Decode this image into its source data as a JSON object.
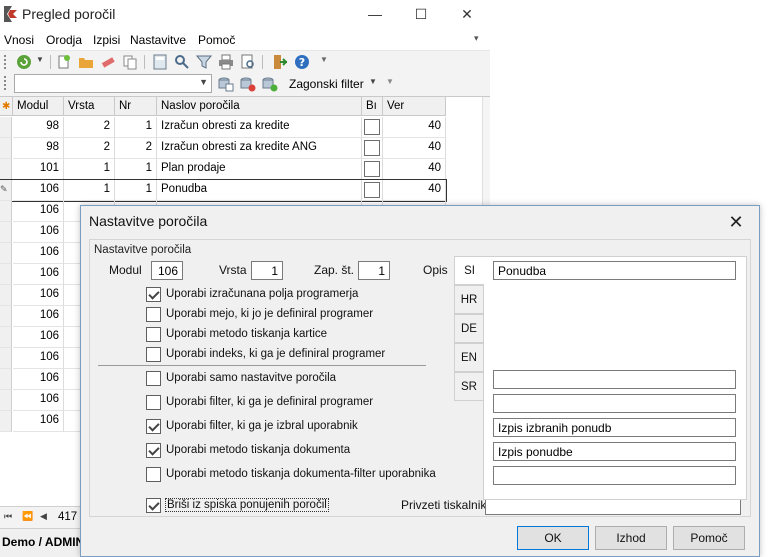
{
  "window": {
    "title": "Pregled poročil",
    "minimize": "—",
    "maximize": "☐",
    "close": "✕"
  },
  "menu": {
    "items": [
      {
        "label": "Vnosi"
      },
      {
        "label": "Orodja"
      },
      {
        "label": "Izpisi"
      },
      {
        "label": "Nastavitve"
      },
      {
        "label": "Pomoč"
      }
    ]
  },
  "toolbar": {
    "filter_label": "Zagonski filter",
    "combo_value": ""
  },
  "grid": {
    "columns": [
      "Modul",
      "Vrsta",
      "Nr",
      "Naslov poročila",
      "Bı",
      "Ver"
    ],
    "rows": [
      {
        "modul": "98",
        "vrsta": "2",
        "nr": "1",
        "naslov": "Izračun obresti za kredite",
        "ver": "40"
      },
      {
        "modul": "98",
        "vrsta": "2",
        "nr": "2",
        "naslov": "Izračun obresti za kredite ANG",
        "ver": "40"
      },
      {
        "modul": "101",
        "vrsta": "1",
        "nr": "1",
        "naslov": "Plan prodaje",
        "ver": "40"
      },
      {
        "modul": "106",
        "vrsta": "1",
        "nr": "1",
        "naslov": "Ponudba",
        "ver": "40"
      },
      {
        "modul": "106"
      },
      {
        "modul": "106"
      },
      {
        "modul": "106"
      },
      {
        "modul": "106"
      },
      {
        "modul": "106"
      },
      {
        "modul": "106"
      },
      {
        "modul": "106"
      },
      {
        "modul": "106"
      },
      {
        "modul": "106"
      },
      {
        "modul": "106"
      },
      {
        "modul": "106"
      }
    ],
    "footer_count": "417 o"
  },
  "status": {
    "text": "Demo / ADMIN"
  },
  "dialog": {
    "title": "Nastavitve poročila",
    "group_title": "Nastavitve poročila",
    "modul_label": "Modul",
    "modul_value": "106",
    "vrsta_label": "Vrsta",
    "vrsta_value": "1",
    "zap_label": "Zap. št.",
    "zap_value": "1",
    "opis_label": "Opis",
    "options_top": [
      {
        "label": "Uporabi izračunana polja programerja",
        "checked": true
      },
      {
        "label": "Uporabi mejo, ki jo je definiral programer",
        "checked": false
      },
      {
        "label": "Uporabi metodo tiskanja kartice",
        "checked": false
      },
      {
        "label": "Uporabi indeks, ki ga je definiral programer",
        "checked": false
      }
    ],
    "options_bottom": [
      {
        "label": "Uporabi samo nastavitve poročila",
        "checked": false
      },
      {
        "label": "Uporabi filter, ki ga je definiral programer",
        "checked": false
      },
      {
        "label": "Uporabi filter, ki ga je izbral uporabnik",
        "checked": true
      },
      {
        "label": "Uporabi metodo tiskanja dokumenta",
        "checked": true
      },
      {
        "label": "Uporabi metodo tiskanja dokumenta-filter uporabnika",
        "checked": false
      }
    ],
    "remove_option": {
      "label": "Briši iz spiska ponujenih poročil",
      "checked": true
    },
    "lang_tabs": [
      "SI",
      "HR",
      "DE",
      "EN",
      "SR"
    ],
    "opis_fields": [
      "Ponudba",
      "",
      "",
      "Izpis izbranih ponudb",
      "Izpis ponudbe",
      ""
    ],
    "printer_label": "Privzeti tiskalnik",
    "printer_value": "",
    "buttons": {
      "ok": "OK",
      "cancel": "Izhod",
      "help": "Pomoč"
    }
  }
}
